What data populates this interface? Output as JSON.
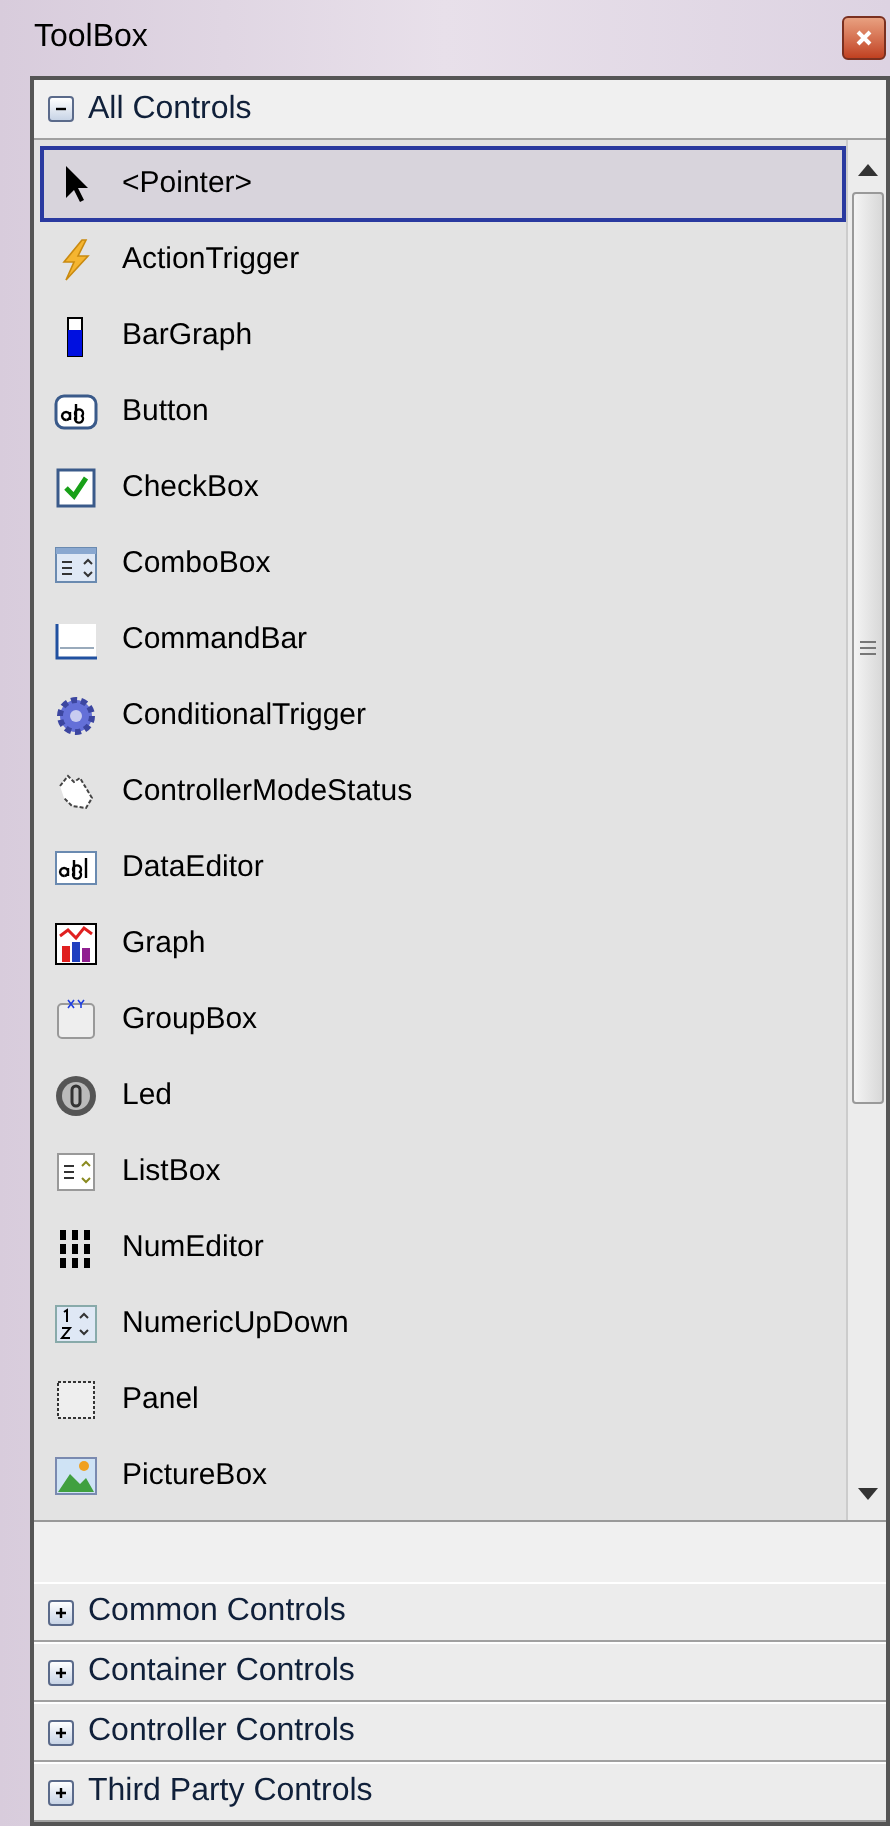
{
  "window": {
    "title": "ToolBox"
  },
  "sections": [
    {
      "label": "All Controls",
      "expanded": true,
      "items": [
        {
          "label": "<Pointer>",
          "selected": true
        },
        {
          "label": "ActionTrigger",
          "selected": false
        },
        {
          "label": "BarGraph",
          "selected": false
        },
        {
          "label": "Button",
          "selected": false
        },
        {
          "label": "CheckBox",
          "selected": false
        },
        {
          "label": "ComboBox",
          "selected": false
        },
        {
          "label": "CommandBar",
          "selected": false
        },
        {
          "label": "ConditionalTrigger",
          "selected": false
        },
        {
          "label": "ControllerModeStatus",
          "selected": false
        },
        {
          "label": "DataEditor",
          "selected": false
        },
        {
          "label": "Graph",
          "selected": false
        },
        {
          "label": "GroupBox",
          "selected": false
        },
        {
          "label": "Led",
          "selected": false
        },
        {
          "label": "ListBox",
          "selected": false
        },
        {
          "label": "NumEditor",
          "selected": false
        },
        {
          "label": "NumericUpDown",
          "selected": false
        },
        {
          "label": "Panel",
          "selected": false
        },
        {
          "label": "PictureBox",
          "selected": false
        }
      ]
    },
    {
      "label": "Common Controls",
      "expanded": false
    },
    {
      "label": "Container Controls",
      "expanded": false
    },
    {
      "label": "Controller Controls",
      "expanded": false
    },
    {
      "label": "Third Party Controls",
      "expanded": false
    }
  ]
}
